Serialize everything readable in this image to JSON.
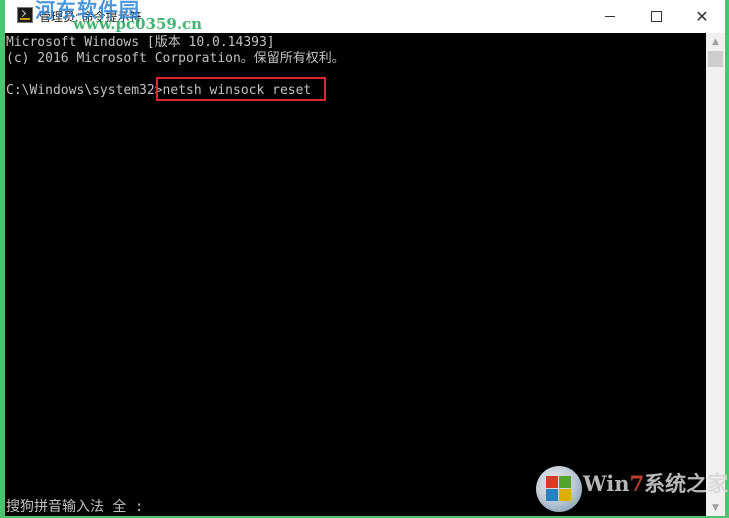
{
  "titlebar": {
    "title": "管理员: 命令提示符",
    "watermark_site": "河东软件园",
    "watermark_url": "www.pc0359.cn",
    "controls": {
      "minimize": "minimize-icon",
      "maximize": "maximize-icon",
      "close": "close-icon"
    }
  },
  "console": {
    "lines": [
      "Microsoft Windows [版本 10.0.14393]",
      "(c) 2016 Microsoft Corporation。保留所有权利。",
      "",
      "C:\\Windows\\system32>netsh winsock reset"
    ],
    "prompt": "C:\\Windows\\system32>",
    "command": "netsh winsock reset",
    "ime_status": "搜狗拼音输入法 全 :"
  },
  "watermark_corner": {
    "text_prefix": "Win",
    "text_seven": "7",
    "text_suffix": "系统之家"
  },
  "colors": {
    "console_bg": "#000000",
    "console_fg": "#c0c0c0",
    "highlight_box": "#e0262b",
    "window_border": "#4cc46e"
  }
}
